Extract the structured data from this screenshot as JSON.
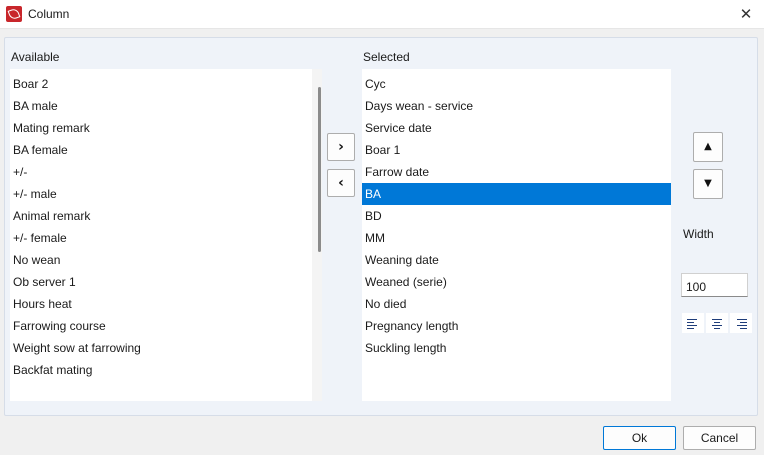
{
  "window": {
    "title": "Column",
    "close_glyph": "✕"
  },
  "available": {
    "label": "Available",
    "items": [
      "Boar 2",
      "BA male",
      "Mating remark",
      "BA female",
      "+/-",
      "+/- male",
      "Animal remark",
      "+/- female",
      "No wean",
      "Ob server 1",
      "Hours heat",
      "Farrowing course",
      "Weight sow at farrowing",
      "Backfat mating"
    ]
  },
  "selected": {
    "label": "Selected",
    "items": [
      "Cyc",
      "Days wean - service",
      "Service date",
      "Boar 1",
      "Farrow date",
      "BA",
      "BD",
      "MM",
      "Weaning date",
      "Weaned (serie)",
      "No died",
      "Pregnancy length",
      "Suckling length"
    ],
    "highlighted_item": "BA"
  },
  "transfer": {
    "add_glyph": "›",
    "remove_glyph": "‹"
  },
  "order": {
    "up_glyph": "▲",
    "down_glyph": "▼"
  },
  "width": {
    "label": "Width",
    "value": "100"
  },
  "alignment": [
    "align-left-icon",
    "align-center-icon",
    "align-right-icon"
  ],
  "buttons": {
    "ok": "Ok",
    "cancel": "Cancel"
  },
  "colors": {
    "selection": "#0078d7",
    "panel": "#eff3f9",
    "icon": "#c8262b"
  }
}
